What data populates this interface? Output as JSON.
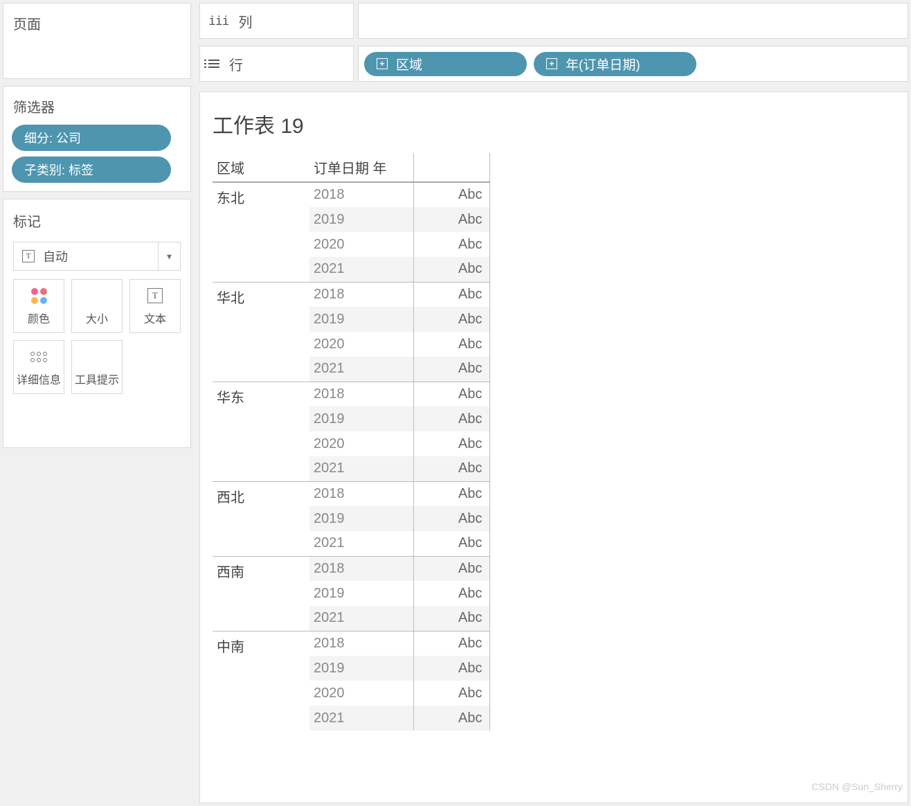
{
  "pages": {
    "title": "页面"
  },
  "filters": {
    "title": "筛选器",
    "pills": [
      "细分: 公司",
      "子类别: 标签"
    ]
  },
  "marks": {
    "title": "标记",
    "selector": "自动",
    "cards": {
      "color": "颜色",
      "size": "大小",
      "text": "文本",
      "detail": "详细信息",
      "tooltip": "工具提示"
    }
  },
  "shelves": {
    "columns_label": "列",
    "rows_label": "行",
    "row_pills": [
      "区域",
      "年(订单日期)"
    ]
  },
  "worksheet": {
    "title": "工作表 19",
    "headers": {
      "region": "区域",
      "year": "订单日期 年"
    },
    "placeholder": "Abc",
    "groups": [
      {
        "region": "东北",
        "years": [
          "2018",
          "2019",
          "2020",
          "2021"
        ],
        "alt_start": 1
      },
      {
        "region": "华北",
        "years": [
          "2018",
          "2019",
          "2020",
          "2021"
        ],
        "alt_start": 1
      },
      {
        "region": "华东",
        "years": [
          "2018",
          "2019",
          "2020",
          "2021"
        ],
        "alt_start": 1
      },
      {
        "region": "西北",
        "years": [
          "2018",
          "2019",
          "2021"
        ],
        "alt_start": 1
      },
      {
        "region": "西南",
        "years": [
          "2018",
          "2019",
          "2021"
        ],
        "alt_start": 0
      },
      {
        "region": "中南",
        "years": [
          "2018",
          "2019",
          "2020",
          "2021"
        ],
        "alt_start": 1
      }
    ]
  },
  "watermark": "CSDN @Sun_Sherry"
}
